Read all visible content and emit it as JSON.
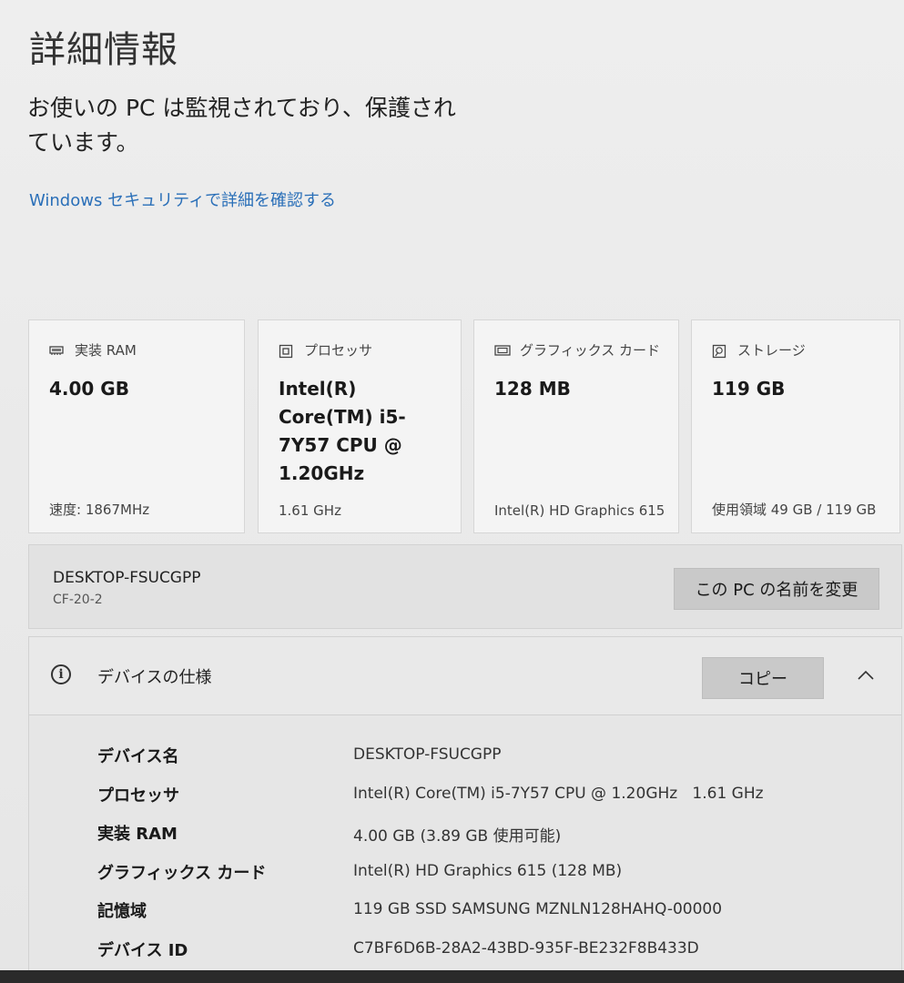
{
  "page": {
    "title": "詳細情報",
    "protection_message": "お使いの PC は監視されており、保護されています。",
    "security_link": "Windows セキュリティで詳細を確認する"
  },
  "cards": [
    {
      "icon": "ram-icon",
      "label": "実装 RAM",
      "value": "4.00 GB",
      "sub": "速度: 1867MHz"
    },
    {
      "icon": "processor-icon",
      "label": "プロセッサ",
      "value": "Intel(R) Core(TM) i5-7Y57 CPU @ 1.20GHz",
      "sub": "1.61 GHz"
    },
    {
      "icon": "graphics-card-icon",
      "label": "グラフィックス カード",
      "value": "128 MB",
      "sub": "Intel(R) HD Graphics 615"
    },
    {
      "icon": "storage-icon",
      "label": "ストレージ",
      "value": "119 GB",
      "sub": "使用領域 49 GB / 119 GB"
    }
  ],
  "pc": {
    "name": "DESKTOP-FSUCGPP",
    "model": "CF-20-2",
    "rename_label": "この PC の名前を変更"
  },
  "device_specs": {
    "title": "デバイスの仕様",
    "copy_label": "コピー",
    "rows": [
      {
        "key": "デバイス名",
        "value": "DESKTOP-FSUCGPP"
      },
      {
        "key": "プロセッサ",
        "value": "Intel(R) Core(TM) i5-7Y57 CPU @ 1.20GHz   1.61 GHz"
      },
      {
        "key": "実装 RAM",
        "value": "4.00 GB (3.89 GB 使用可能)"
      },
      {
        "key": "グラフィックス カード",
        "value": "Intel(R) HD Graphics 615 (128 MB)"
      },
      {
        "key": "記憶域",
        "value": "119 GB SSD SAMSUNG MZNLN128HAHQ-00000"
      },
      {
        "key": "デバイス ID",
        "value": "C7BF6D6B-28A2-43BD-935F-BE232F8B433D"
      }
    ]
  },
  "colors": {
    "link": "#2a6fb8",
    "button": "#c9c9c9",
    "background": "#ececec"
  }
}
